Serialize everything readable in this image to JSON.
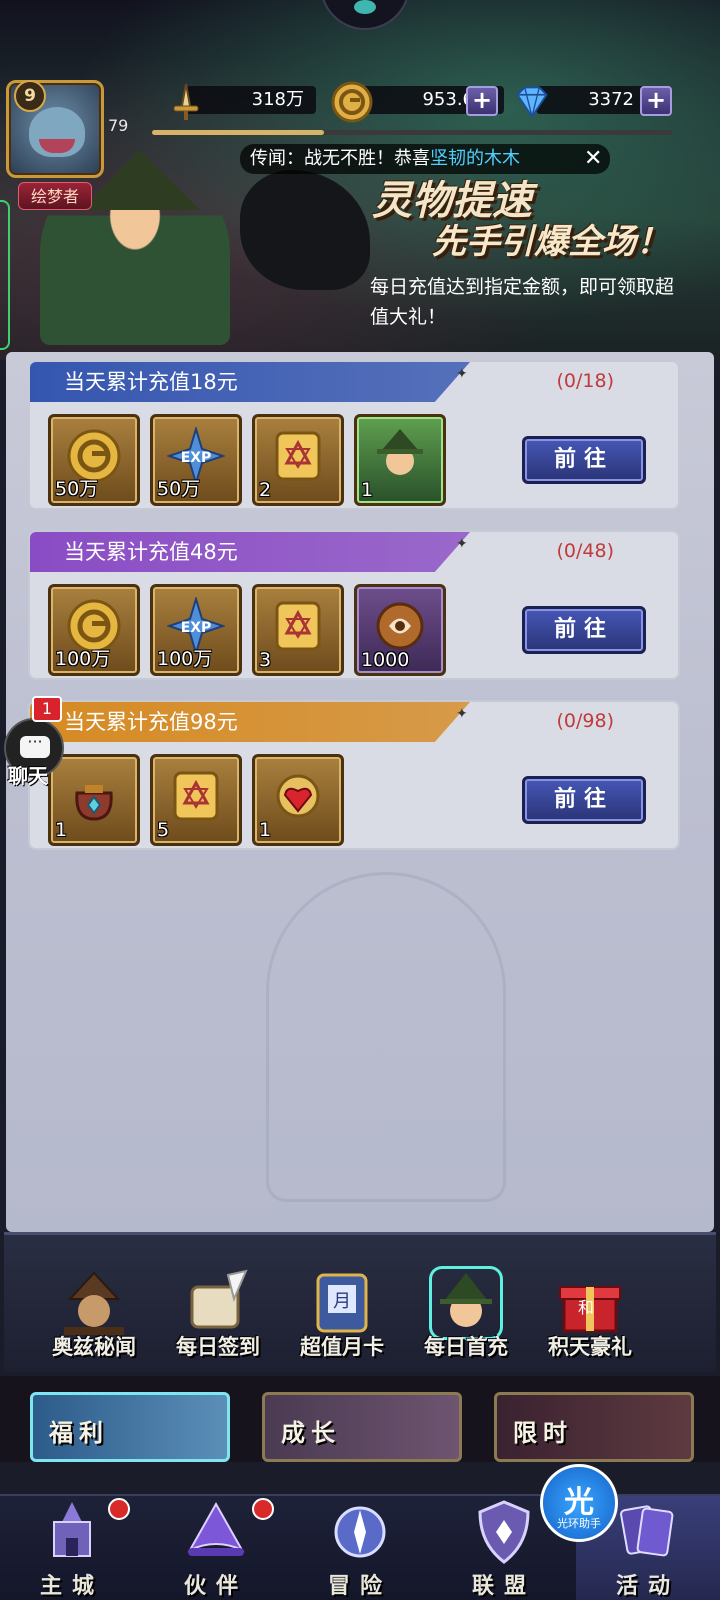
{
  "player": {
    "level": "9",
    "avatar_level": "79",
    "title": "绘梦者",
    "xp_progress_percent": 33
  },
  "resources": {
    "power": "318万",
    "gold": "953.6万",
    "gems": "3372"
  },
  "rumor": {
    "prefix": "传闻：战无不胜！恭喜",
    "name": "坚韧的木木"
  },
  "banner": {
    "title_line1": "灵物提速",
    "title_line2": "先手引爆全场！",
    "description": "每日充值达到指定金额，即可领取超值大礼！"
  },
  "tiers": [
    {
      "label": "当天累计充值18元",
      "progress": "(0/18)",
      "button": "前往",
      "color": "#3556b0",
      "items": [
        {
          "icon": "gold-coin-icon",
          "qty": "50万"
        },
        {
          "icon": "exp-star-icon",
          "qty": "50万"
        },
        {
          "icon": "scroll-ticket-icon",
          "qty": "2"
        },
        {
          "icon": "witch-hero-card-icon",
          "qty": "1"
        }
      ]
    },
    {
      "label": "当天累计充值48元",
      "progress": "(0/48)",
      "button": "前往",
      "color": "#8a4cc4",
      "items": [
        {
          "icon": "gold-coin-icon",
          "qty": "100万"
        },
        {
          "icon": "exp-star-icon",
          "qty": "100万"
        },
        {
          "icon": "scroll-ticket-icon",
          "qty": "3"
        },
        {
          "icon": "spirit-orb-icon",
          "qty": "1000"
        }
      ]
    },
    {
      "label": "当天累计充值98元",
      "progress": "(0/98)",
      "button": "前往",
      "color": "#d68a22",
      "items": [
        {
          "icon": "treasure-bag-icon",
          "qty": "1"
        },
        {
          "icon": "scroll-ticket-icon",
          "qty": "5"
        },
        {
          "icon": "red-gem-icon",
          "qty": "1"
        }
      ]
    }
  ],
  "chat": {
    "badge": "1",
    "label": "聊天"
  },
  "activities": [
    {
      "label": "奥兹秘闻",
      "icon": "scarecrow-icon"
    },
    {
      "label": "每日签到",
      "icon": "scroll-quill-icon"
    },
    {
      "label": "超值月卡",
      "icon": "month-card-icon"
    },
    {
      "label": "每日首充",
      "icon": "witch-portrait-icon"
    },
    {
      "label": "积天豪礼",
      "icon": "gift-box-icon"
    }
  ],
  "categories": [
    {
      "label": "福利"
    },
    {
      "label": "成长"
    },
    {
      "label": "限时"
    }
  ],
  "nav": [
    {
      "label": "主城",
      "icon": "castle-icon",
      "dot": true
    },
    {
      "label": "伙伴",
      "icon": "wizard-hat-icon",
      "dot": true
    },
    {
      "label": "冒险",
      "icon": "compass-icon",
      "dot": false
    },
    {
      "label": "联盟",
      "icon": "shield-icon",
      "dot": false
    },
    {
      "label": "活动",
      "icon": "cards-icon",
      "dot": false
    }
  ],
  "assistant": {
    "big": "光",
    "small": "光环助手"
  },
  "colors": {
    "progress_red": "#c23a3a",
    "button_blue": "#3f4fae",
    "panel_bg": "#c4c7d6"
  }
}
